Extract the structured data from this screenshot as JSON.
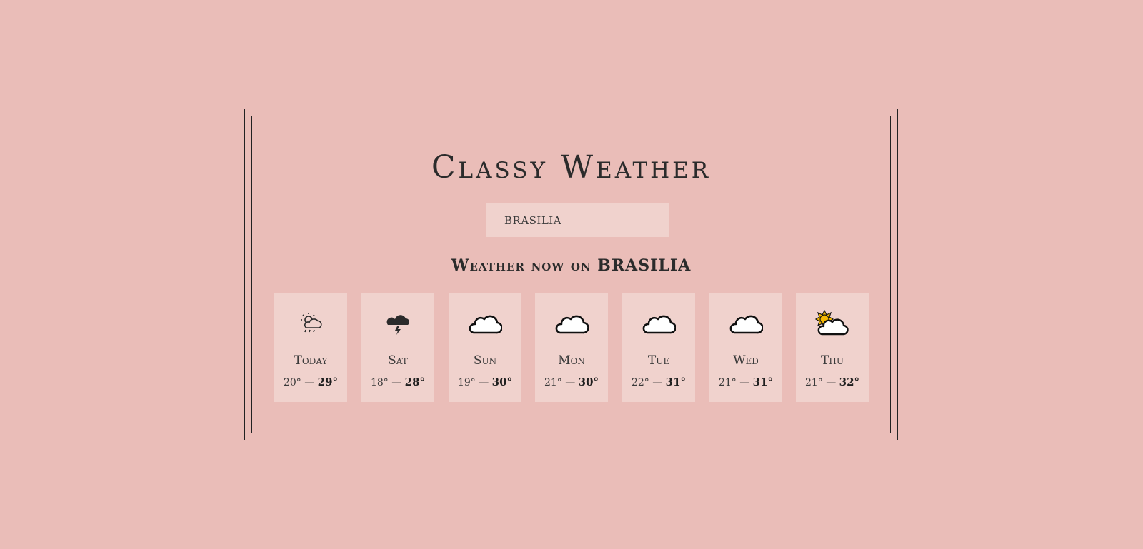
{
  "app": {
    "title": "Classy Weather"
  },
  "search": {
    "value": "BRASILIA"
  },
  "weather": {
    "heading": "Weather now on BRASILIA",
    "days": [
      {
        "label": "Today",
        "min": "20°",
        "max": "29°",
        "icon": "sun-cloud-rain-icon"
      },
      {
        "label": "Sat",
        "min": "18°",
        "max": "28°",
        "icon": "thunderstorm-icon"
      },
      {
        "label": "Sun",
        "min": "19°",
        "max": "30°",
        "icon": "cloud-icon"
      },
      {
        "label": "Mon",
        "min": "21°",
        "max": "30°",
        "icon": "cloud-icon"
      },
      {
        "label": "Tue",
        "min": "22°",
        "max": "31°",
        "icon": "cloud-icon"
      },
      {
        "label": "Wed",
        "min": "21°",
        "max": "31°",
        "icon": "cloud-icon"
      },
      {
        "label": "Thu",
        "min": "21°",
        "max": "32°",
        "icon": "sun-behind-cloud-icon"
      }
    ],
    "separator": "—"
  },
  "colors": {
    "background": "#eabdb8",
    "card": "#f0d2cd",
    "text": "#2b2b2b",
    "sun": "#f5b800"
  }
}
